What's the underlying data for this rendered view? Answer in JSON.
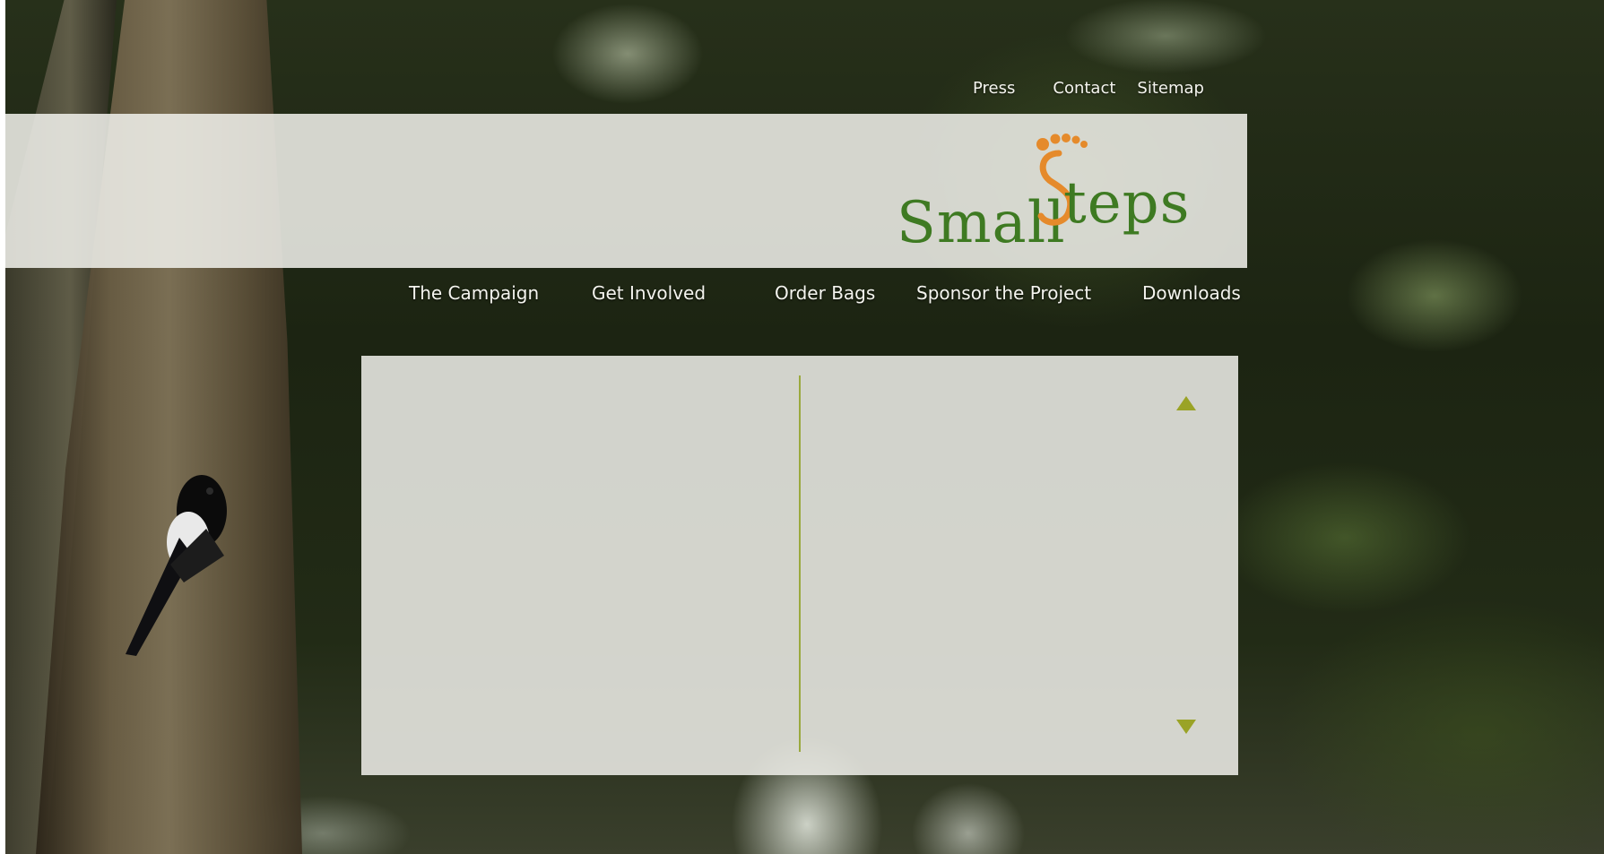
{
  "top_links": [
    "Press",
    "Contact",
    "Sitemap"
  ],
  "logo": {
    "word_small": "Small",
    "word_teps": "teps",
    "brand_green": "#3e7a22",
    "brand_orange": "#e58a2b"
  },
  "main_nav": [
    "The Campaign",
    "Get Involved",
    "Order Bags",
    "Sponsor the Project",
    "Downloads"
  ],
  "colors": {
    "accent_olive": "#9aa326",
    "divider": "#9aa93e",
    "panel": "#ececE6"
  }
}
